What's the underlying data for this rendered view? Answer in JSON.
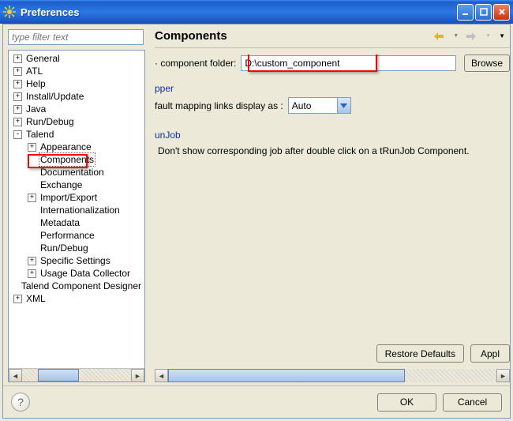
{
  "window": {
    "title": "Preferences"
  },
  "filter": {
    "placeholder": "type filter text"
  },
  "tree": {
    "items": [
      {
        "level": 0,
        "exp": "plus",
        "label": "General"
      },
      {
        "level": 0,
        "exp": "plus",
        "label": "ATL"
      },
      {
        "level": 0,
        "exp": "plus",
        "label": "Help"
      },
      {
        "level": 0,
        "exp": "plus",
        "label": "Install/Update"
      },
      {
        "level": 0,
        "exp": "plus",
        "label": "Java"
      },
      {
        "level": 0,
        "exp": "plus",
        "label": "Run/Debug"
      },
      {
        "level": 0,
        "exp": "minus",
        "label": "Talend"
      },
      {
        "level": 1,
        "exp": "plus",
        "label": "Appearance"
      },
      {
        "level": 1,
        "exp": "none",
        "label": "Components",
        "selected": true
      },
      {
        "level": 1,
        "exp": "none",
        "label": "Documentation"
      },
      {
        "level": 1,
        "exp": "none",
        "label": "Exchange"
      },
      {
        "level": 1,
        "exp": "plus",
        "label": "Import/Export"
      },
      {
        "level": 1,
        "exp": "none",
        "label": "Internationalization"
      },
      {
        "level": 1,
        "exp": "none",
        "label": "Metadata"
      },
      {
        "level": 1,
        "exp": "none",
        "label": "Performance"
      },
      {
        "level": 1,
        "exp": "none",
        "label": "Run/Debug"
      },
      {
        "level": 1,
        "exp": "plus",
        "label": "Specific Settings"
      },
      {
        "level": 1,
        "exp": "plus",
        "label": "Usage Data Collector"
      },
      {
        "level": 0,
        "exp": "none",
        "label": "Talend Component Designer"
      },
      {
        "level": 0,
        "exp": "plus",
        "label": "XML"
      }
    ]
  },
  "page": {
    "title": "Components",
    "component_folder_label": "· component folder:",
    "component_folder_value": "D:\\custom_component",
    "browse_label": "Browse",
    "section_pper": "pper",
    "mapping_label": "fault mapping links display as :",
    "mapping_value": "Auto",
    "section_unjob": "unJob",
    "unjob_text": "Don't show corresponding job after double click on a tRunJob Component.",
    "restore_defaults": "Restore Defaults",
    "apply": "Appl"
  },
  "footer": {
    "ok": "OK",
    "cancel": "Cancel"
  }
}
